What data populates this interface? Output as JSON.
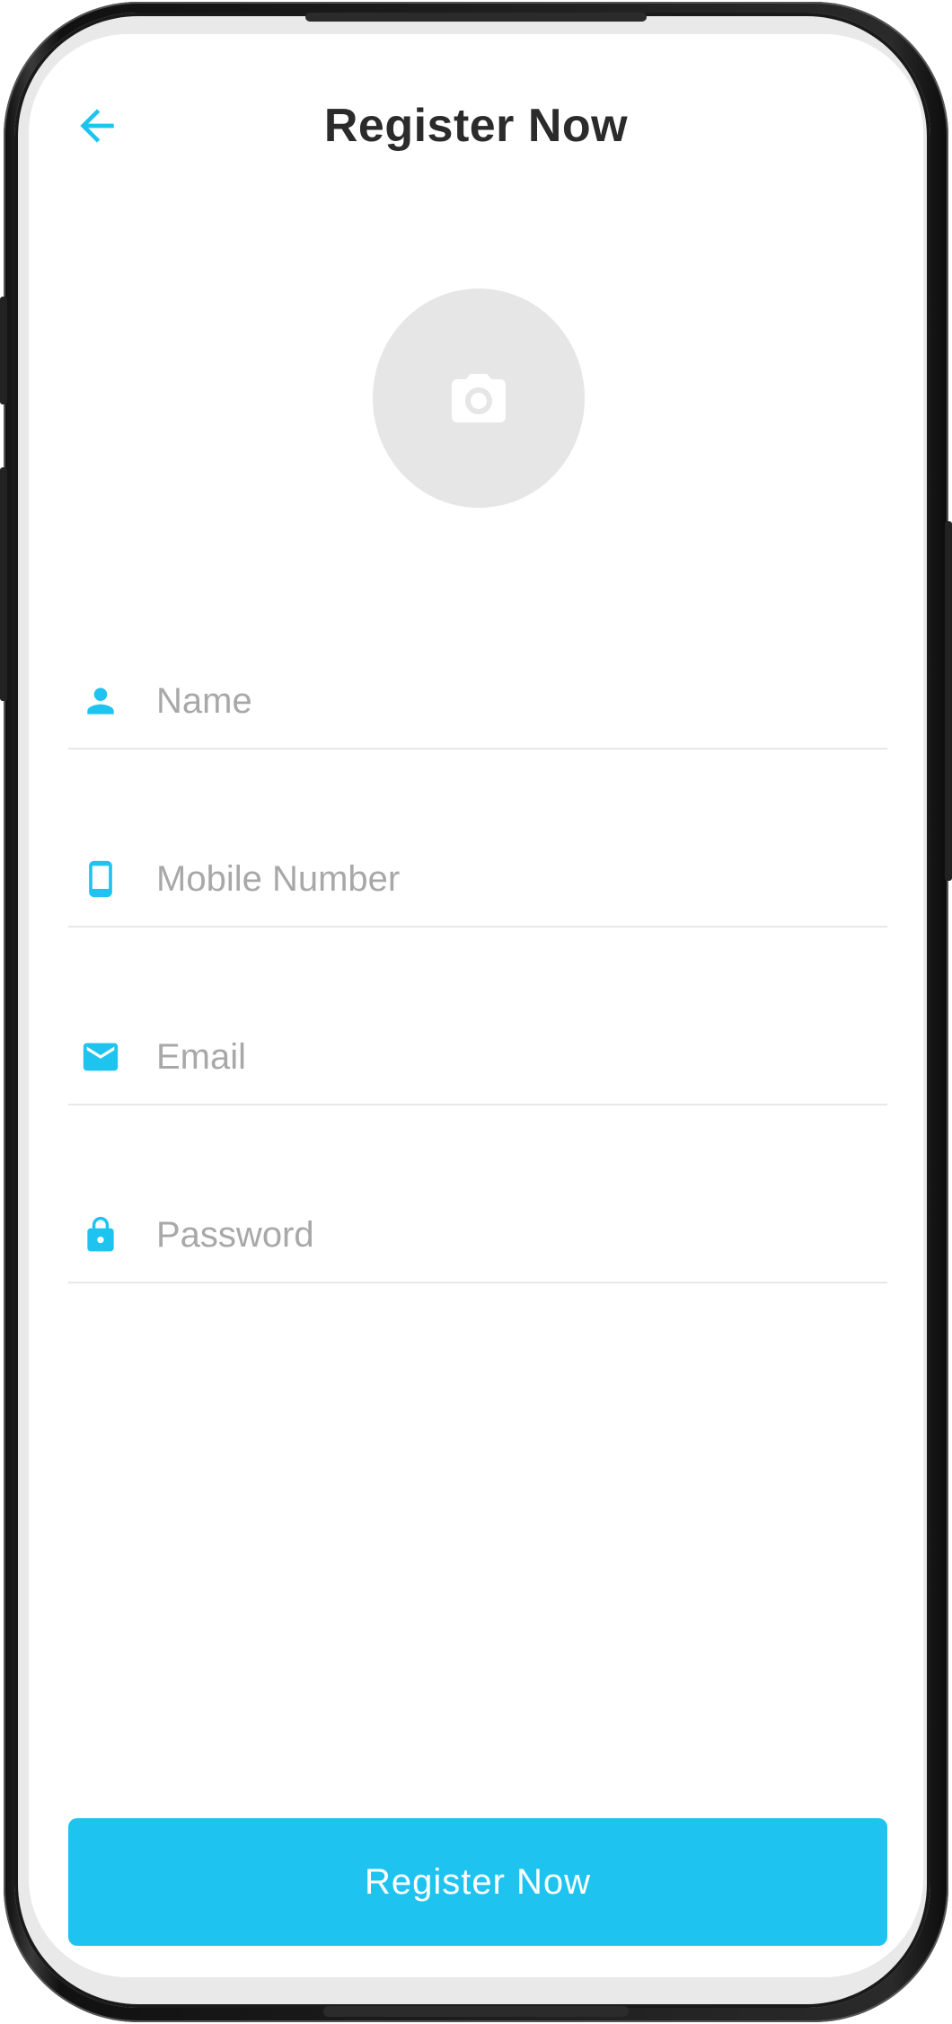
{
  "header": {
    "title": "Register Now",
    "back_icon": "arrow-left-icon"
  },
  "avatar": {
    "icon": "camera-icon"
  },
  "form": {
    "fields": [
      {
        "icon": "person-icon",
        "placeholder": "Name",
        "value": ""
      },
      {
        "icon": "smartphone-icon",
        "placeholder": "Mobile Number",
        "value": ""
      },
      {
        "icon": "mail-icon",
        "placeholder": "Email",
        "value": ""
      },
      {
        "icon": "lock-icon",
        "placeholder": "Password",
        "value": ""
      }
    ]
  },
  "actions": {
    "register_label": "Register Now"
  },
  "colors": {
    "accent": "#1EC4EF",
    "title_text": "#2B2B2B",
    "placeholder_text": "#A8A8A8",
    "avatar_bg": "#E6E6E6",
    "divider": "#E8E8E8"
  }
}
